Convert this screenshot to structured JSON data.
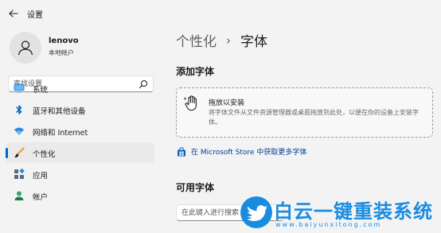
{
  "window": {
    "title": "设置"
  },
  "user": {
    "name": "lenovo",
    "account_type": "本地帐户"
  },
  "search": {
    "placeholder": "查找设置"
  },
  "sidebar": {
    "items": [
      {
        "label": "系统",
        "icon": "monitor-icon",
        "selected": false
      },
      {
        "label": "蓝牙和其他设备",
        "icon": "bluetooth-icon",
        "selected": false
      },
      {
        "label": "网络和 Internet",
        "icon": "wifi-icon",
        "selected": false
      },
      {
        "label": "个性化",
        "icon": "brush-icon",
        "selected": true
      },
      {
        "label": "应用",
        "icon": "apps-icon",
        "selected": false
      },
      {
        "label": "帐户",
        "icon": "person-icon",
        "selected": false
      }
    ]
  },
  "breadcrumb": {
    "parent": "个性化",
    "separator": "›",
    "current": "字体"
  },
  "add_fonts": {
    "heading": "添加字体",
    "drop_title": "拖放以安装",
    "drop_description": "将字体文件从文件资源管理器或桌面拖放到此处，以便在你的设备上安装字体。"
  },
  "store_link": {
    "label": "在 Microsoft Store 中获取更多字体"
  },
  "available_fonts": {
    "heading": "可用字体",
    "search_placeholder": "在此键入进行搜索"
  },
  "watermark": {
    "title": "白云一键重装系统",
    "url": "www.baiyunxitong.com"
  },
  "colors": {
    "accent": "#0067c0",
    "link": "#003e92",
    "watermark": "#1a8ce0",
    "background": "#f3f3f3"
  }
}
